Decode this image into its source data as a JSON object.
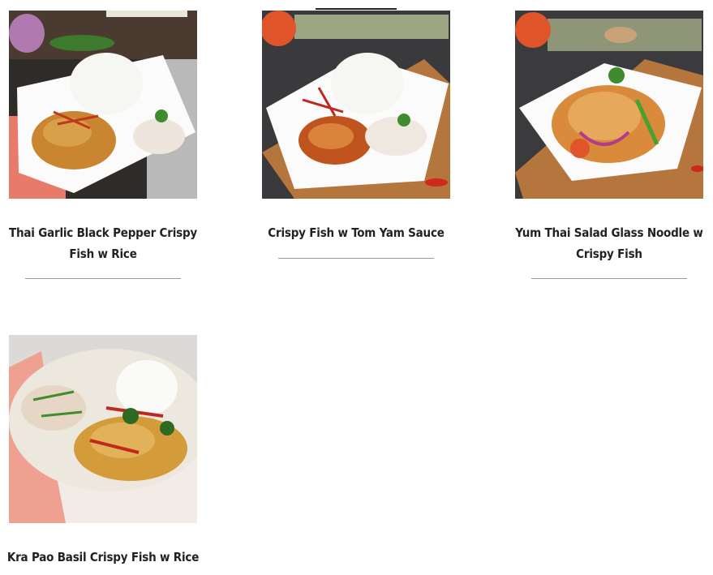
{
  "menu": {
    "items": [
      {
        "title": "Thai Garlic Black Pepper Crispy Fish w Rice",
        "image_icon": "dish-photo-garlic-pepper-fish",
        "accent_colors": {
          "sauce": "#c9852f",
          "table": "#2e2b29"
        }
      },
      {
        "title": "Crispy Fish w Tom Yam Sauce",
        "image_icon": "dish-photo-tom-yam-fish",
        "accent_colors": {
          "sauce": "#c0541f",
          "table": "#3a3a3c"
        }
      },
      {
        "title": "Yum Thai Salad Glass Noodle w Crispy Fish",
        "image_icon": "dish-photo-yum-thai-salad",
        "accent_colors": {
          "sauce": "#d98a3a",
          "table": "#3b3b3e"
        }
      },
      {
        "title": "Kra Pao Basil Crispy Fish w Rice",
        "image_icon": "dish-photo-kra-pao-basil",
        "accent_colors": {
          "sauce": "#d49b3a",
          "table": "#f4c6bb"
        }
      }
    ]
  }
}
